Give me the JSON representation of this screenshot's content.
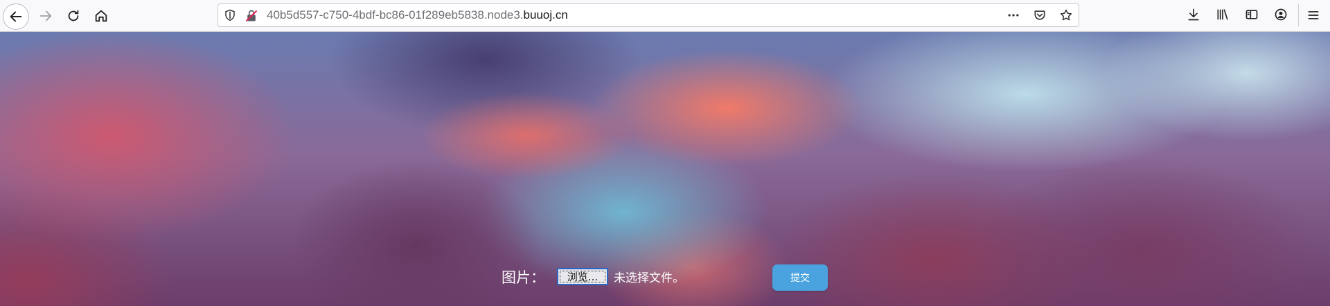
{
  "browser": {
    "url_prefix": "40b5d557-c750-4bdf-bc86-01f289eb5838.node3.",
    "url_domain": "buuoj.cn",
    "icons": {
      "back": "back-arrow-icon",
      "forward": "forward-arrow-icon",
      "reload": "reload-icon",
      "home": "home-icon",
      "tracking": "shield-icon",
      "insecure": "insecure-lock-icon",
      "more": "more-actions-icon",
      "pocket": "pocket-icon",
      "bookmark": "star-icon",
      "download": "download-icon",
      "library": "library-icon",
      "sidebar": "sidebar-icon",
      "account": "account-icon",
      "menu": "hamburger-menu-icon"
    }
  },
  "form": {
    "picture_label": "图片：",
    "browse_button": "浏览...",
    "file_status": "未选择文件。",
    "submit_button": "提交",
    "submit_color": "#4aa3df"
  }
}
